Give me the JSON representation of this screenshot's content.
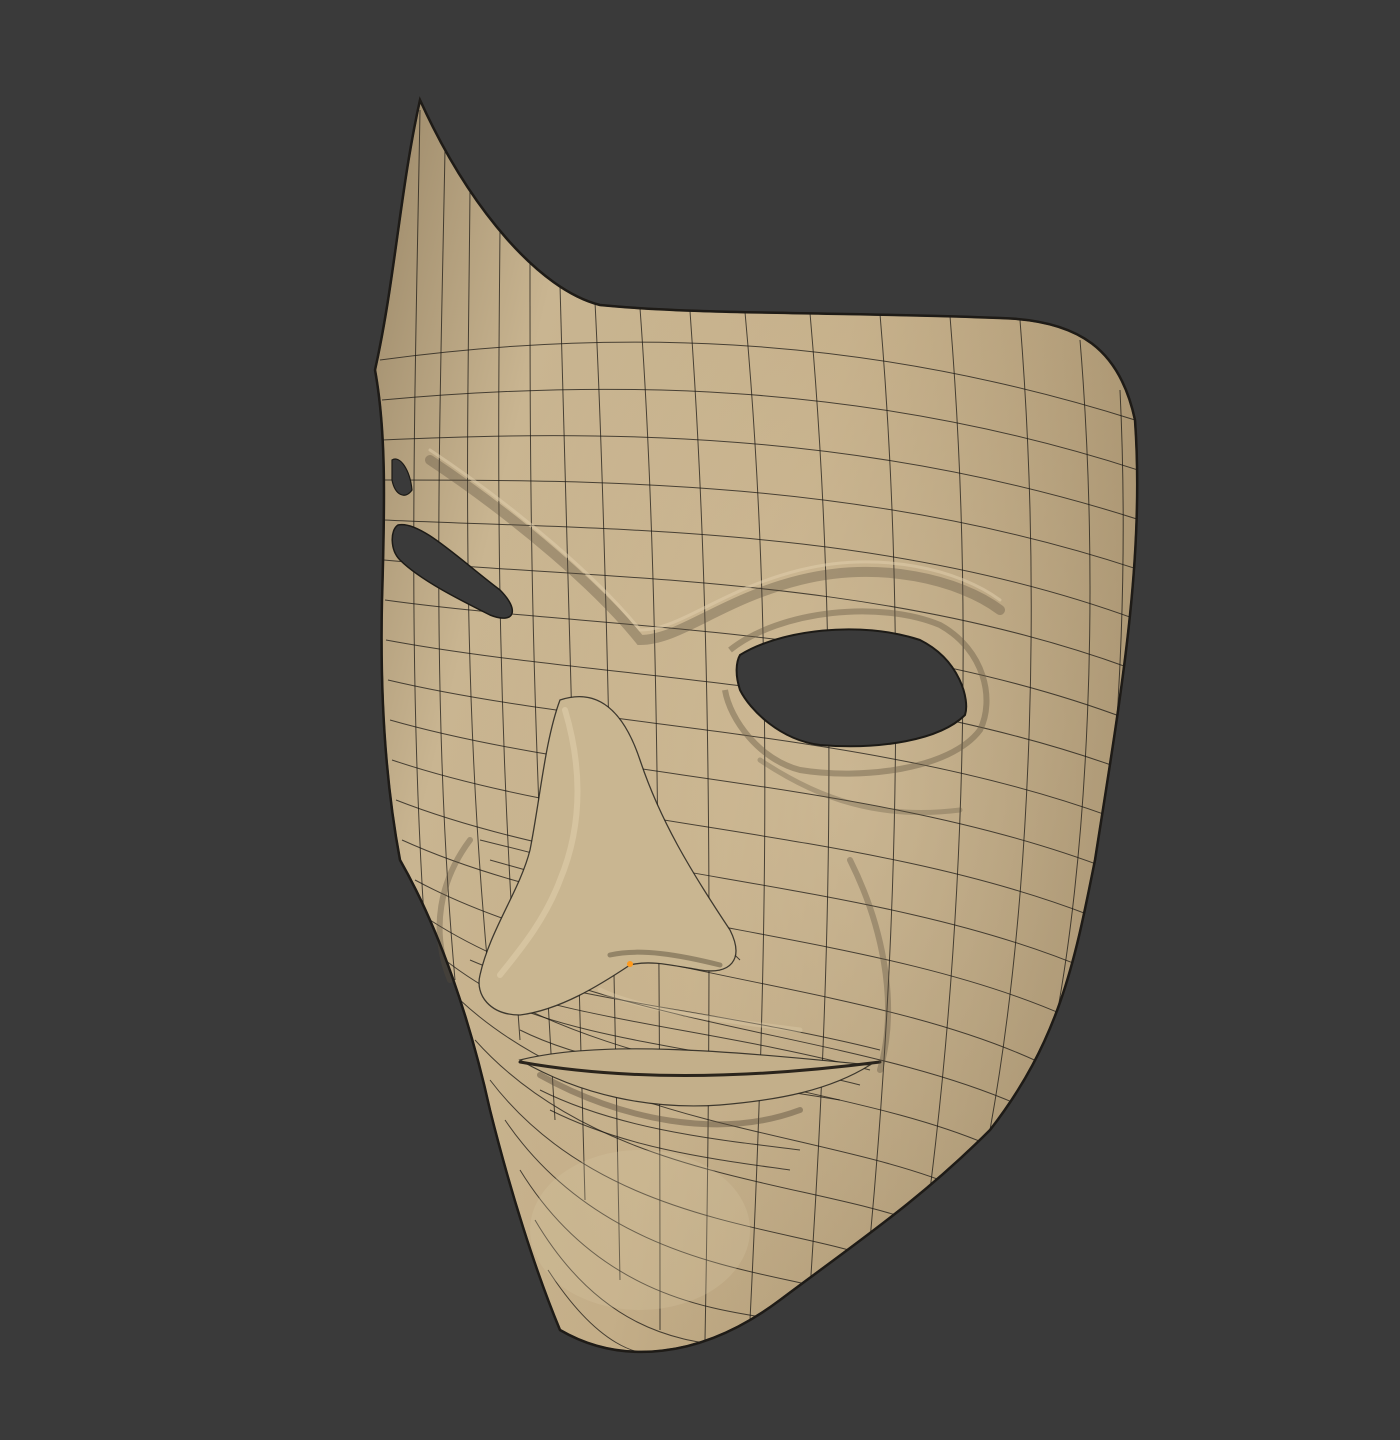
{
  "viewport": {
    "background_color": "#3a3a3a",
    "mesh_color": "#c4b08c",
    "wire_color": "#1c1a16",
    "selection_color": "#ff9a1c",
    "object": "wireframe-mask-model"
  }
}
